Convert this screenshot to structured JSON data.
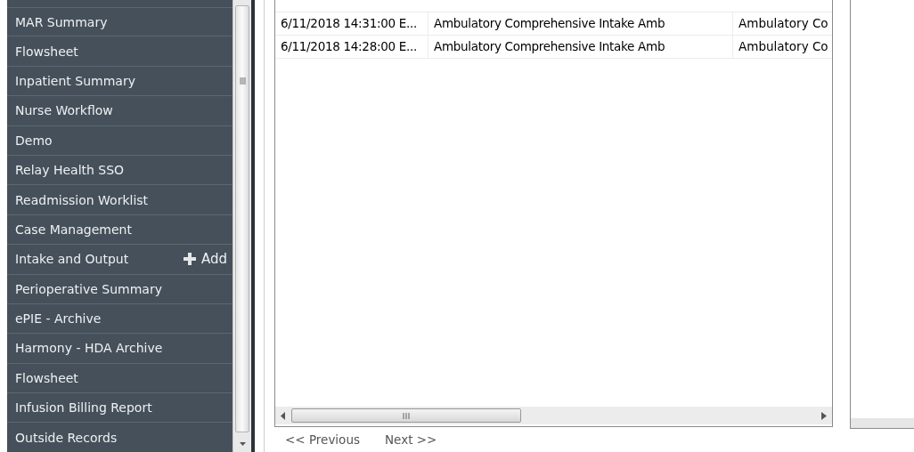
{
  "sidebar": {
    "items": [
      {
        "label": "MAR Summary"
      },
      {
        "label": "Flowsheet"
      },
      {
        "label": "Inpatient Summary"
      },
      {
        "label": "Nurse Workflow"
      },
      {
        "label": "Demo"
      },
      {
        "label": "Relay Health SSO"
      },
      {
        "label": "Readmission Worklist"
      },
      {
        "label": "Case Management"
      },
      {
        "label": "Intake and Output",
        "action": "Add"
      },
      {
        "label": "Perioperative Summary"
      },
      {
        "label": "ePIE - Archive"
      },
      {
        "label": "Harmony - HDA Archive"
      },
      {
        "label": "Flowsheet"
      },
      {
        "label": "Infusion Billing Report"
      },
      {
        "label": "Outside Records"
      }
    ]
  },
  "table": {
    "rows": [
      {
        "column_1": "6/11/2018 14:31:00 E...",
        "column_2": "Ambulatory Comprehensive Intake Amb",
        "column_3": "Ambulatory Co"
      },
      {
        "column_1": "6/11/2018 14:28:00 E...",
        "column_2": "Ambulatory Comprehensive Intake Amb",
        "column_3": "Ambulatory Co"
      }
    ]
  },
  "pagination": {
    "previous": "<< Previous",
    "next": "Next >>"
  }
}
